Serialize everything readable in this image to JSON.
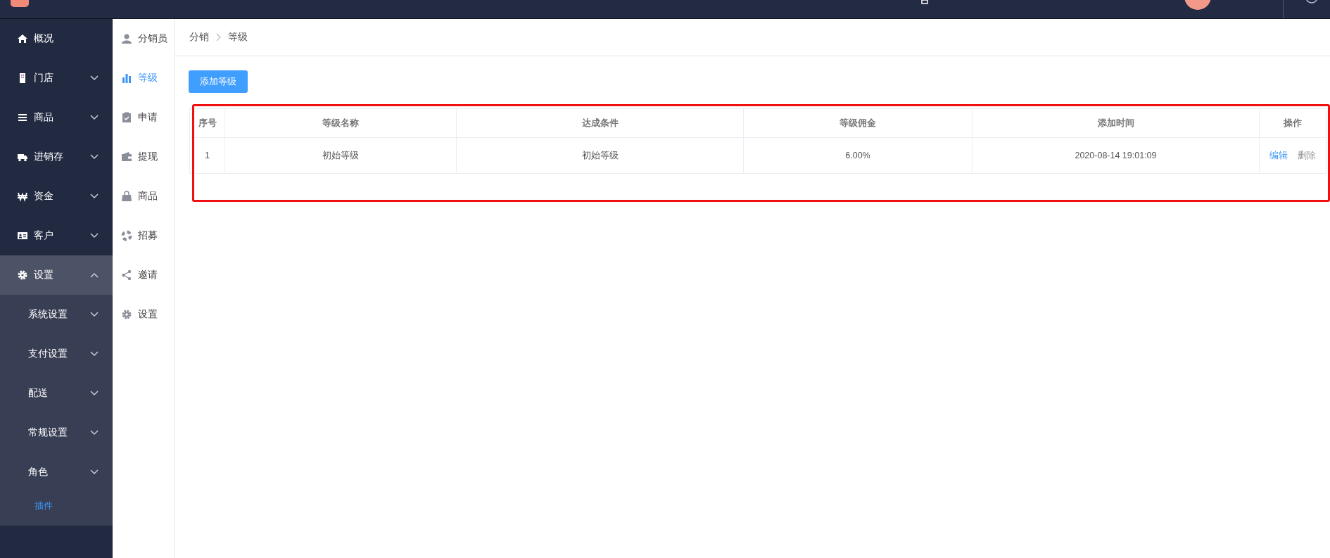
{
  "main_nav": [
    {
      "label": "概况",
      "kind": "link",
      "selected": false
    },
    {
      "label": "门店",
      "kind": "group",
      "expanded": false,
      "selected": false
    },
    {
      "label": "商品",
      "kind": "group",
      "expanded": false,
      "selected": false
    },
    {
      "label": "进销存",
      "kind": "group",
      "expanded": false,
      "selected": false
    },
    {
      "label": "资金",
      "kind": "group",
      "expanded": false,
      "selected": false
    },
    {
      "label": "客户",
      "kind": "group",
      "expanded": false,
      "selected": false
    },
    {
      "label": "设置",
      "kind": "group",
      "expanded": true,
      "selected": true,
      "children": [
        {
          "label": "系统设置",
          "kind": "group",
          "expanded": false,
          "selected": false
        },
        {
          "label": "支付设置",
          "kind": "group",
          "expanded": false,
          "selected": false
        },
        {
          "label": "配送",
          "kind": "group",
          "expanded": false,
          "selected": false
        },
        {
          "label": "常规设置",
          "kind": "group",
          "expanded": false,
          "selected": false
        },
        {
          "label": "角色",
          "kind": "group",
          "expanded": false,
          "selected": false
        },
        {
          "label": "插件",
          "kind": "link",
          "selected": true
        }
      ]
    }
  ],
  "sub_nav": [
    {
      "label": "分销员",
      "selected": false
    },
    {
      "label": "等级",
      "selected": true
    },
    {
      "label": "申请",
      "selected": false
    },
    {
      "label": "提现",
      "selected": false
    },
    {
      "label": "商品",
      "selected": false
    },
    {
      "label": "招募",
      "selected": false
    },
    {
      "label": "邀请",
      "selected": false
    },
    {
      "label": "设置",
      "selected": false
    }
  ],
  "breadcrumb": [
    "分销",
    "等级"
  ],
  "add_button": "添加等级",
  "table": {
    "columns": [
      "序号",
      "等级名称",
      "达成条件",
      "等级佣金",
      "添加时间",
      "操作"
    ],
    "rows": [
      {
        "cells": [
          "1",
          "初始等级",
          "初始等级",
          "6.00%",
          "2020-08-14 19:01:09"
        ],
        "actions": [
          {
            "label": "编辑",
            "kind": "primary"
          },
          {
            "label": "删除",
            "kind": "muted"
          }
        ]
      }
    ]
  }
}
